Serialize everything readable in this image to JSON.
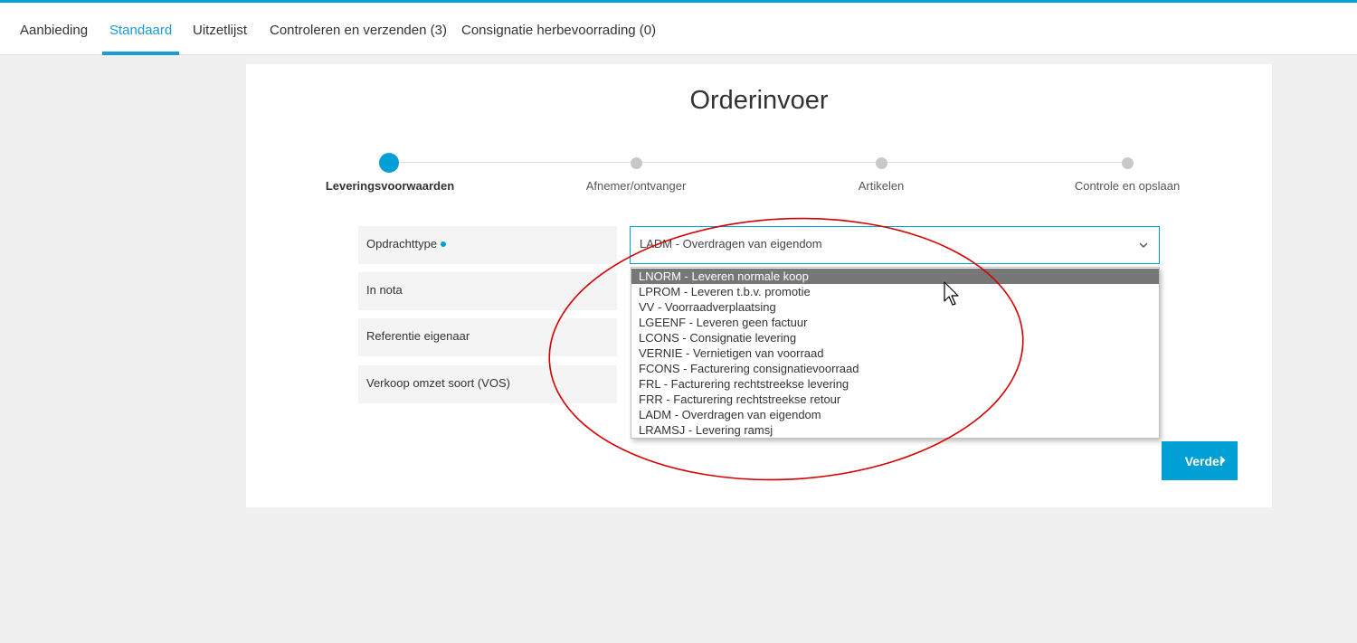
{
  "tabs": [
    {
      "label": "Aanbieding"
    },
    {
      "label": "Standaard"
    },
    {
      "label": "Uitzetlijst"
    },
    {
      "label": "Controleren en verzenden (3)"
    },
    {
      "label": "Consignatie herbevoorrading (0)"
    }
  ],
  "active_tab": "Standaard",
  "page": {
    "title": "Orderinvoer"
  },
  "steps": [
    {
      "label": "Leveringsvoorwaarden"
    },
    {
      "label": "Afnemer/ontvanger"
    },
    {
      "label": "Artikelen"
    },
    {
      "label": "Controle en opslaan"
    }
  ],
  "active_step": "Leveringsvoorwaarden",
  "fields": [
    {
      "label": "Opdrachttype",
      "required": true
    },
    {
      "label": "In nota"
    },
    {
      "label": "Referentie eigenaar"
    },
    {
      "label": "Verkoop omzet soort (VOS)"
    }
  ],
  "select": {
    "value": "LADM - Overdragen van eigendom",
    "icon": "chevron-down-icon",
    "highlighted_option": "LNORM - Leveren normale koop",
    "options": [
      "LNORM - Leveren normale koop",
      "LPROM - Leveren t.b.v. promotie",
      "VV - Voorraadverplaatsing",
      "LGEENF - Leveren geen factuur",
      "LCONS - Consignatie levering",
      "VERNIE - Vernietigen van voorraad",
      "FCONS - Facturering consignatievoorraad",
      "FRL - Facturering rechtstreekse levering",
      "FRR - Facturering rechtstreekse retour",
      "LADM - Overdragen van eigendom",
      "LRAMSJ - Levering ramsj"
    ]
  },
  "buttons": {
    "next_label": "Verder",
    "next_icon": "chevron-right-icon"
  },
  "colors": {
    "accent": "#00a0d6",
    "highlight": "#777777",
    "annotation": "#d40000"
  }
}
